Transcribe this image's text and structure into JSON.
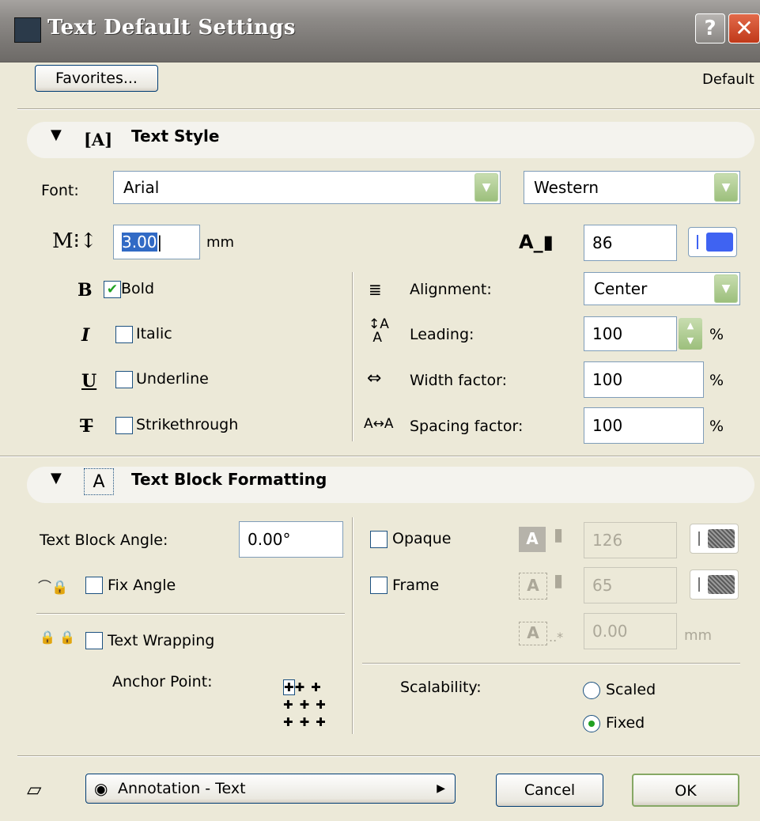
{
  "window": {
    "title": "Text Default Settings",
    "help": "?",
    "close": "✕"
  },
  "top": {
    "favorites_label": "Favorites...",
    "default_label": "Default"
  },
  "text_style": {
    "title": "Text Style",
    "font_label": "Font:",
    "font_value": "Arial",
    "script_value": "Western",
    "size_value": "3.00",
    "size_unit": "mm",
    "pen_value": "86",
    "bold_label": "Bold",
    "bold_checked": true,
    "italic_label": "Italic",
    "underline_label": "Underline",
    "strike_label": "Strikethrough",
    "alignment_label": "Alignment:",
    "alignment_value": "Center",
    "leading_label": "Leading:",
    "leading_value": "100",
    "leading_unit": "%",
    "width_label": "Width factor:",
    "width_value": "100",
    "width_unit": "%",
    "spacing_label": "Spacing factor:",
    "spacing_value": "100",
    "spacing_unit": "%"
  },
  "text_block": {
    "title": "Text Block Formatting",
    "angle_label": "Text Block Angle:",
    "angle_value": "0.00°",
    "fix_angle_label": "Fix Angle",
    "wrap_label": "Text Wrapping",
    "anchor_label": "Anchor Point:",
    "opaque_label": "Opaque",
    "opaque_pen": "126",
    "frame_label": "Frame",
    "frame_pen": "65",
    "offset_value": "0.00",
    "offset_unit": "mm",
    "scalability_label": "Scalability:",
    "scaled_label": "Scaled",
    "fixed_label": "Fixed",
    "scalability_selected": "Fixed"
  },
  "bottom": {
    "layer_value": "Annotation - Text",
    "cancel_label": "Cancel",
    "ok_label": "OK"
  },
  "colors": {
    "pen_blue": "#3f63f2",
    "checkbox_green": "#21a121",
    "dialog_bg": "#ece9d8"
  }
}
